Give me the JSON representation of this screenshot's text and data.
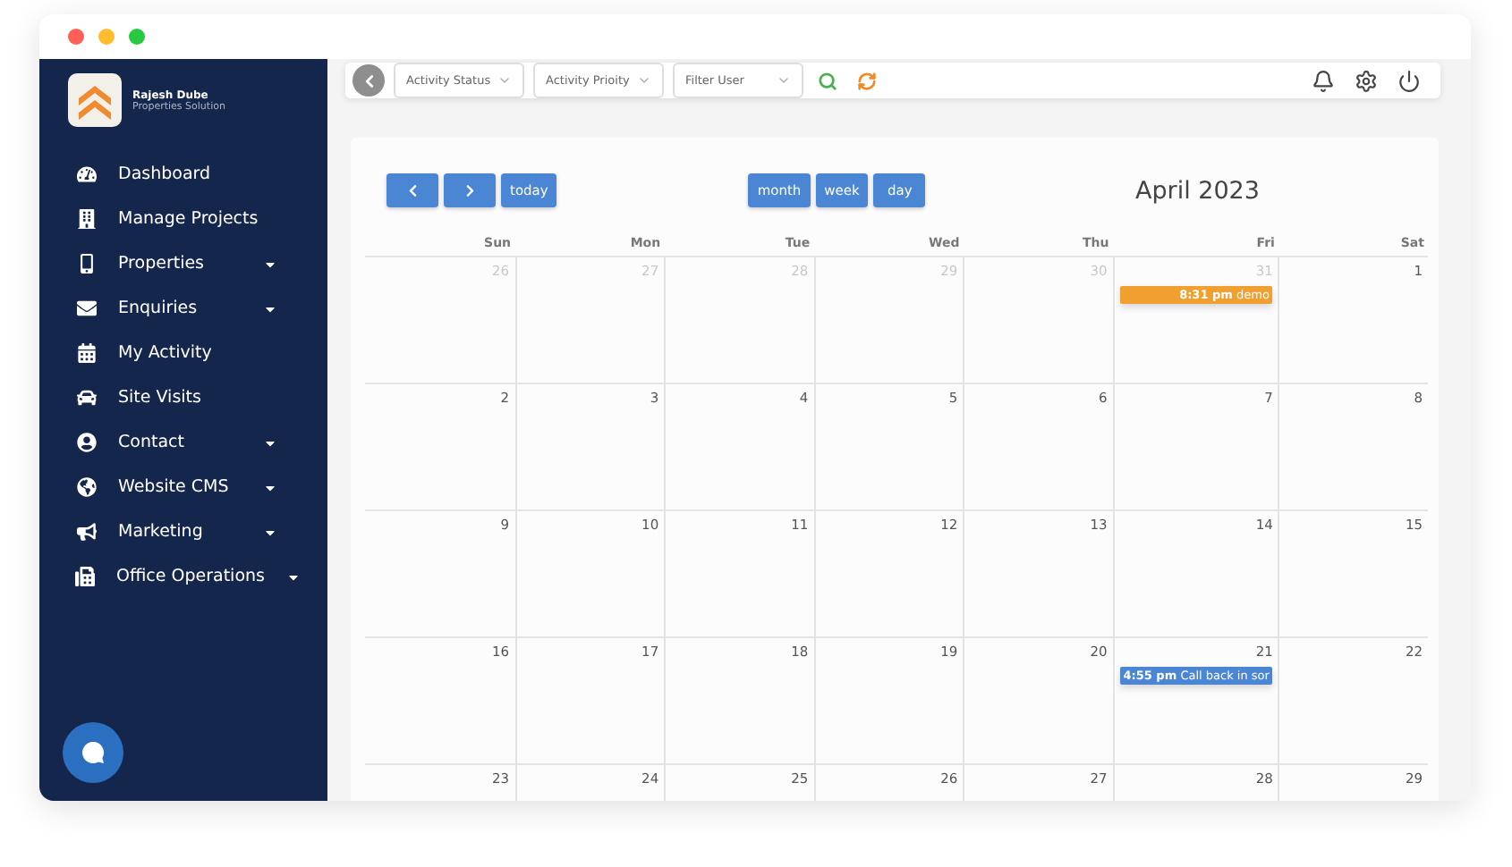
{
  "sidebar": {
    "brand": {
      "name": "Rajesh Dube",
      "subtitle": "Properties Solution"
    },
    "items": [
      {
        "label": "Dashboard",
        "has_submenu": false
      },
      {
        "label": "Manage Projects",
        "has_submenu": false
      },
      {
        "label": "Properties",
        "has_submenu": true
      },
      {
        "label": "Enquiries",
        "has_submenu": true
      },
      {
        "label": "My Activity",
        "has_submenu": false
      },
      {
        "label": "Site Visits",
        "has_submenu": false
      },
      {
        "label": "Contact",
        "has_submenu": true
      },
      {
        "label": "Website CMS",
        "has_submenu": true
      },
      {
        "label": "Marketing",
        "has_submenu": true
      },
      {
        "label": "Office Operations",
        "has_submenu": true
      }
    ]
  },
  "filters": [
    {
      "label": "Activity Status"
    },
    {
      "label": "Activity Prioity"
    },
    {
      "label": "Filter User"
    }
  ],
  "calendar": {
    "title": "April 2023",
    "today_button": "today",
    "views": [
      "month",
      "week",
      "day"
    ],
    "weekdays": [
      "Sun",
      "Mon",
      "Tue",
      "Wed",
      "Thu",
      "Fri",
      "Sat"
    ],
    "weeks": [
      [
        {
          "day": "26",
          "other_month": true
        },
        {
          "day": "27",
          "other_month": true
        },
        {
          "day": "28",
          "other_month": true
        },
        {
          "day": "29",
          "other_month": true
        },
        {
          "day": "30",
          "other_month": true
        },
        {
          "day": "31",
          "other_month": true,
          "events": [
            {
              "time": "8:31 pm",
              "title": "demo",
              "color": "#f0a030"
            }
          ]
        },
        {
          "day": "1",
          "other_month": false
        }
      ],
      [
        {
          "day": "2",
          "other_month": false
        },
        {
          "day": "3",
          "other_month": false
        },
        {
          "day": "4",
          "other_month": false
        },
        {
          "day": "5",
          "other_month": false
        },
        {
          "day": "6",
          "other_month": false
        },
        {
          "day": "7",
          "other_month": false
        },
        {
          "day": "8",
          "other_month": false
        }
      ],
      [
        {
          "day": "9",
          "other_month": false
        },
        {
          "day": "10",
          "other_month": false
        },
        {
          "day": "11",
          "other_month": false
        },
        {
          "day": "12",
          "other_month": false
        },
        {
          "day": "13",
          "other_month": false
        },
        {
          "day": "14",
          "other_month": false
        },
        {
          "day": "15",
          "other_month": false
        }
      ],
      [
        {
          "day": "16",
          "other_month": false
        },
        {
          "day": "17",
          "other_month": false
        },
        {
          "day": "18",
          "other_month": false
        },
        {
          "day": "19",
          "other_month": false
        },
        {
          "day": "20",
          "other_month": false
        },
        {
          "day": "21",
          "other_month": false,
          "events": [
            {
              "time": "4:55 pm",
              "title": "Call back in sor",
              "color": "#4a86d4"
            }
          ]
        },
        {
          "day": "22",
          "other_month": false
        }
      ],
      [
        {
          "day": "23",
          "other_month": false
        },
        {
          "day": "24",
          "other_month": false
        },
        {
          "day": "25",
          "other_month": false
        },
        {
          "day": "26",
          "other_month": false
        },
        {
          "day": "27",
          "other_month": false
        },
        {
          "day": "28",
          "other_month": false
        },
        {
          "day": "29",
          "other_month": false
        }
      ]
    ]
  }
}
